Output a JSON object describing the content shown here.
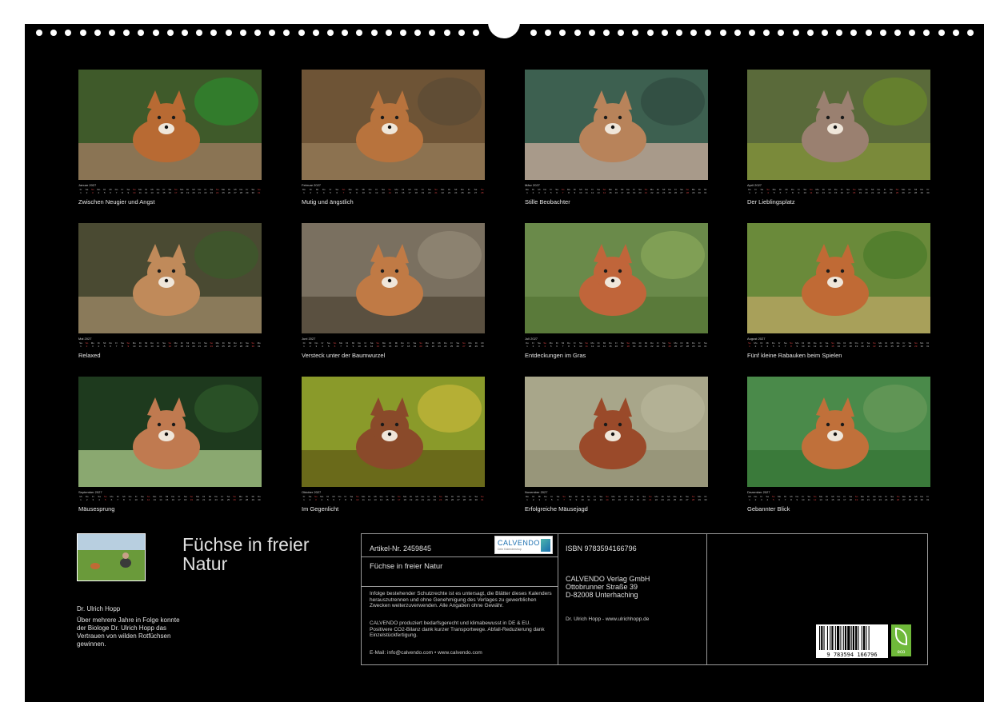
{
  "calendar": {
    "title": "Füchse in freier Natur",
    "months": [
      {
        "name": "Januar 2027",
        "caption": "Zwischen Neugier und Angst",
        "days": 31,
        "sundays": [
          3,
          10,
          17,
          24,
          31
        ],
        "scene": {
          "bg": "#3f5a2a",
          "ground": "#8a7454",
          "fox": "#b86a33",
          "accent": "#2e8a2e"
        }
      },
      {
        "name": "Februar 2027",
        "caption": "Mutig und ängstlich",
        "days": 28,
        "sundays": [
          7,
          14,
          21,
          28
        ],
        "scene": {
          "bg": "#6e5436",
          "ground": "#8c7250",
          "fox": "#b8733d",
          "accent": "#5a4a34"
        }
      },
      {
        "name": "März 2027",
        "caption": "Stille Beobachter",
        "days": 31,
        "sundays": [
          7,
          14,
          21,
          28
        ],
        "scene": {
          "bg": "#3d6050",
          "ground": "#a89a8a",
          "fox": "#b8835a",
          "accent": "#2f4a3e"
        }
      },
      {
        "name": "April 2027",
        "caption": "Der Lieblingsplatz",
        "days": 30,
        "sundays": [
          4,
          11,
          18,
          25
        ],
        "scene": {
          "bg": "#5a6a3a",
          "ground": "#7a8a3a",
          "fox": "#9a8070",
          "accent": "#6a8a2a"
        }
      },
      {
        "name": "Mai 2027",
        "caption": "Relaxed",
        "days": 31,
        "sundays": [
          2,
          9,
          16,
          23,
          30
        ],
        "scene": {
          "bg": "#4a4a32",
          "ground": "#8a7a5a",
          "fox": "#c08a5a",
          "accent": "#3a5a2a"
        }
      },
      {
        "name": "Juni 2027",
        "caption": "Versteck unter der Baumwurzel",
        "days": 30,
        "sundays": [
          6,
          13,
          20,
          27
        ],
        "scene": {
          "bg": "#7a7060",
          "ground": "#5a5040",
          "fox": "#c07a45",
          "accent": "#948a78"
        }
      },
      {
        "name": "Juli 2027",
        "caption": "Entdeckungen im Gras",
        "days": 31,
        "sundays": [
          4,
          11,
          18,
          25
        ],
        "scene": {
          "bg": "#6a8a4a",
          "ground": "#5a7a3a",
          "fox": "#c0653a",
          "accent": "#8aa85a"
        }
      },
      {
        "name": "August 2027",
        "caption": "Fünf kleine Rabauken beim Spielen",
        "days": 31,
        "sundays": [
          1,
          8,
          15,
          22,
          29
        ],
        "scene": {
          "bg": "#6a8a3a",
          "ground": "#a8a05a",
          "fox": "#c06a35",
          "accent": "#4a7a2a"
        }
      },
      {
        "name": "September 2027",
        "caption": "Mäusesprung",
        "days": 30,
        "sundays": [
          5,
          12,
          19,
          26
        ],
        "scene": {
          "bg": "#1e3a1e",
          "ground": "#8aa870",
          "fox": "#c07a50",
          "accent": "#2e5a2a"
        }
      },
      {
        "name": "Oktober 2027",
        "caption": "Im Gegenlicht",
        "days": 31,
        "sundays": [
          3,
          10,
          17,
          24,
          31
        ],
        "scene": {
          "bg": "#8a9a2a",
          "ground": "#6a6a1a",
          "fox": "#8a4a2a",
          "accent": "#c8b83a"
        }
      },
      {
        "name": "November 2027",
        "caption": "Erfolgreiche Mäusejagd",
        "days": 30,
        "sundays": [
          7,
          14,
          21,
          28
        ],
        "scene": {
          "bg": "#a8a68a",
          "ground": "#98967a",
          "fox": "#9a4a2a",
          "accent": "#b8b69a"
        }
      },
      {
        "name": "Dezember 2027",
        "caption": "Gebannter Blick",
        "days": 31,
        "sundays": [
          5,
          12,
          19,
          26
        ],
        "scene": {
          "bg": "#4a8a4a",
          "ground": "#3a7a3a",
          "fox": "#c0703a",
          "accent": "#6a9a5a"
        }
      }
    ]
  },
  "author": {
    "name": "Dr. Ulrich Hopp",
    "bio": "Über mehrere Jahre in Folge konnte der Biologe Dr. Ulrich Hopp das Vertrauen von wilden Rotfüchsen gewinnen."
  },
  "info": {
    "article": "Artikel-Nr. 2459845",
    "logo_text": "CALVENDO",
    "logo_sub": "Dein Kalendershop",
    "book_title": "Füchse in freier Natur",
    "legal": "Infolge bestehender Schutzrechte ist es untersagt, die Blätter dieses Kalenders herauszutrennen und ohne Genehmigung des Verlages zu gewerblichen Zwecken weiterzuverwenden. Alle Angaben ohne Gewähr.",
    "eco": "CALVENDO produziert bedarfsgerecht und klimabewusst in DE & EU. Positivere CO2-Bilanz dank kurzer Transportwege. Abfall-Reduzierung dank Einzelstückfertigung.",
    "email": "E-Mail: info@calvendo.com • www.calvendo.com",
    "isbn": "ISBN 9783594166796",
    "publisher_1": "CALVENDO Verlag GmbH",
    "publisher_2": "Ottobrunner Straße 39",
    "publisher_3": "D-82008 Unterhaching",
    "author_url": "Dr. Ulrich Hopp - www.ulrichhopp.de",
    "barcode_number": "9 783594 166796",
    "eco_label": "eco"
  },
  "colors": {
    "board": "#000000",
    "text": "#e0e0e0",
    "sunday": "#d04040",
    "eco_green": "#6fb93a",
    "calvendo_blue": "#1a6fb0"
  }
}
